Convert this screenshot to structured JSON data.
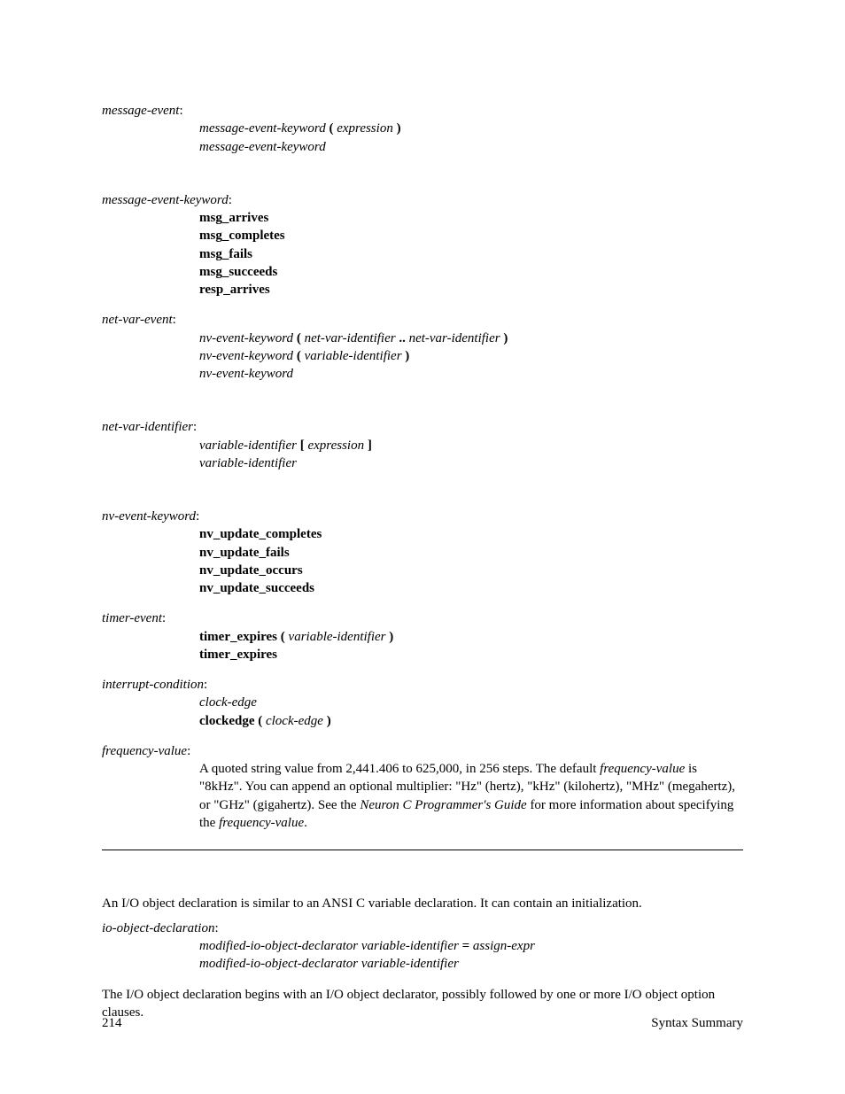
{
  "rules": {
    "message_event": {
      "head": "message-event",
      "line1a": "message-event-keyword",
      "line1b": "(",
      "line1c": "expression",
      "line1d": ")",
      "line2": "message-event-keyword"
    },
    "message_event_keyword": {
      "head": "message-event-keyword",
      "k1": "msg_arrives",
      "k2": "msg_completes",
      "k3": "msg_fails",
      "k4": "msg_succeeds",
      "k5": "resp_arrives"
    },
    "net_var_event": {
      "head": "net-var-event",
      "l1a": "nv-event-keyword",
      "l1b": "(",
      "l1c": "net-var-identifier",
      "l1d": "..",
      "l1e": "net-var-identifier",
      "l1f": ")",
      "l2a": "nv-event-keyword",
      "l2b": "(",
      "l2c": "variable-identifier",
      "l2d": ")",
      "l3": "nv-event-keyword"
    },
    "net_var_identifier": {
      "head": "net-var-identifier",
      "l1a": "variable-identifier",
      "l1b": "[",
      "l1c": "expression",
      "l1d": "]",
      "l2": "variable-identifier"
    },
    "nv_event_keyword": {
      "head": "nv-event-keyword",
      "k1": "nv_update_completes",
      "k2": "nv_update_fails",
      "k3": "nv_update_occurs",
      "k4": "nv_update_succeeds"
    },
    "timer_event": {
      "head": "timer-event",
      "l1a": "timer_expires",
      "l1b": "(",
      "l1c": "variable-identifier",
      "l1d": ")",
      "l2": "timer_expires"
    },
    "interrupt_condition": {
      "head": "interrupt-condition",
      "l1": "clock-edge",
      "l2a": "clockedge (",
      "l2b": "clock-edge",
      "l2c": ")"
    },
    "frequency_value": {
      "head": "frequency-value",
      "desc1": "A quoted string value from 2,441.406 to 625,000, in 256 steps.  The default ",
      "desc2": "frequency-value",
      "desc3": " is \"8kHz\".  You can append an optional multiplier:  \"Hz\" (hertz), \"kHz\" (kilohertz), \"MHz\" (megahertz), or \"GHz\" (gigahertz).  See the ",
      "desc4": "Neuron C Programmer's Guide",
      "desc5": " for more information about specifying the ",
      "desc6": "frequency-value",
      "desc7": "."
    }
  },
  "body": {
    "p1": "An I/O object declaration is similar to an ANSI C variable declaration.  It can contain an initialization.",
    "io_decl": {
      "head": "io-object-declaration",
      "l1a": "modified-io-object-declarator variable-identifier",
      "l1b": "=",
      "l1c": "assign-expr",
      "l2": "modified-io-object-declarator variable-identifier"
    },
    "p2": "The I/O object declaration begins with an I/O object declarator, possibly followed by one or more I/O object option clauses."
  },
  "footer": {
    "page": "214",
    "title": "Syntax Summary"
  },
  "sep": ":"
}
